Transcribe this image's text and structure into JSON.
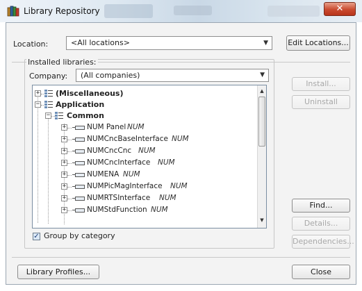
{
  "window": {
    "title": "Library Repository",
    "close_glyph": "✕"
  },
  "location": {
    "label": "Location:",
    "value": "<All locations>",
    "edit_button": "Edit Locations..."
  },
  "installed": {
    "group_title": "Installed libraries:",
    "company_label": "Company:",
    "company_value": "(All companies)",
    "tree": [
      {
        "label": "(Miscellaneous)",
        "kind": "category",
        "expander": "+"
      },
      {
        "label": "Application",
        "kind": "category",
        "expander": "−"
      },
      {
        "label": "Common",
        "kind": "category",
        "expander": "−"
      },
      {
        "label": "NUM Panel",
        "vendor": "NUM",
        "kind": "library",
        "expander": "+"
      },
      {
        "label": "NUMCncBaseInterface",
        "vendor": "NUM",
        "kind": "library",
        "expander": "+"
      },
      {
        "label": "NUMCncCnc",
        "vendor": "NUM",
        "kind": "library",
        "expander": "+"
      },
      {
        "label": "NUMCncInterface",
        "vendor": "NUM",
        "kind": "library",
        "expander": "+"
      },
      {
        "label": "NUMENA",
        "vendor": "NUM",
        "kind": "library",
        "expander": "+"
      },
      {
        "label": "NUMPicMagInterface",
        "vendor": "NUM",
        "kind": "library",
        "expander": "+"
      },
      {
        "label": "NUMRTSInterface",
        "vendor": "NUM",
        "kind": "library",
        "expander": "+"
      },
      {
        "label": "NUMStdFunction",
        "vendor": "NUM",
        "kind": "library",
        "expander": "+"
      }
    ],
    "group_by_category_label": "Group by category",
    "group_by_category_checked": true
  },
  "buttons": {
    "install": "Install...",
    "uninstall": "Uninstall",
    "find": "Find...",
    "details": "Details...",
    "dependencies": "Dependencies...",
    "library_profiles": "Library Profiles...",
    "close": "Close"
  },
  "colors": {
    "close_button": "#c94a2f",
    "tree_border": "#7a8ea2",
    "disabled_text": "#a8a8a8"
  },
  "icons": {
    "app": "books-icon",
    "category": "category-icon",
    "library": "library-icon"
  }
}
